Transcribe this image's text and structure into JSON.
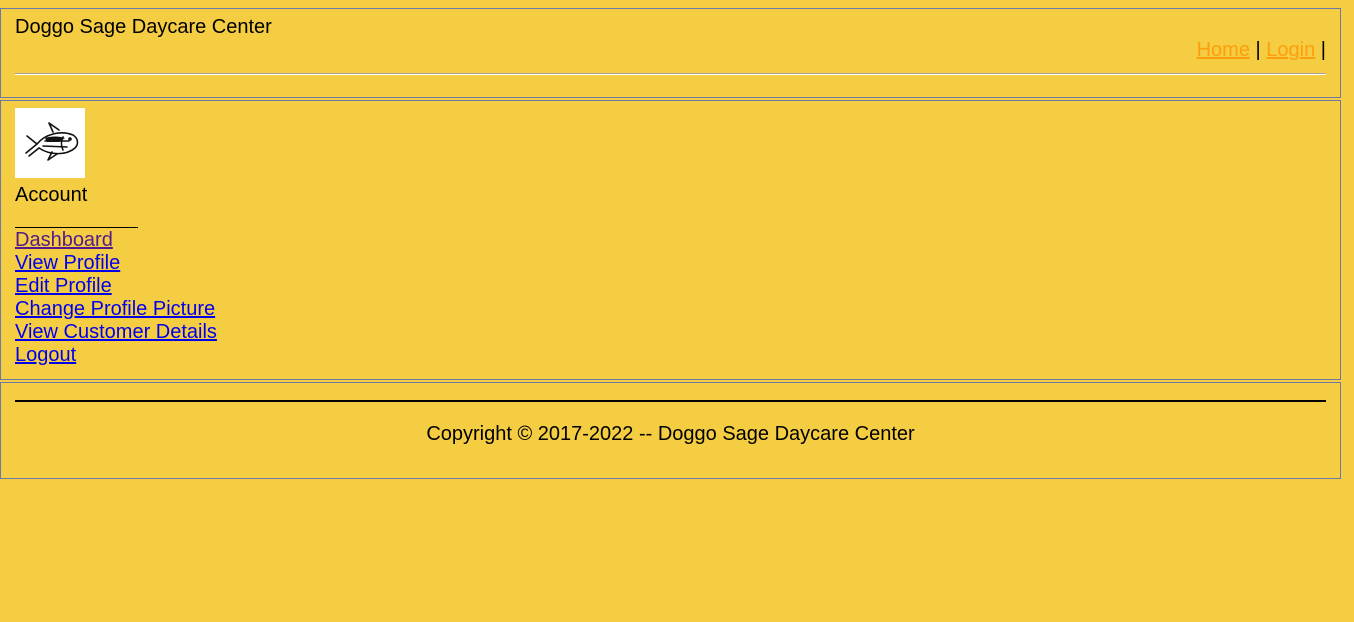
{
  "header": {
    "site_title": "Doggo Sage Daycare Center",
    "nav": [
      {
        "label": "Home"
      },
      {
        "label": "Login"
      }
    ],
    "separator": "|"
  },
  "sidebar": {
    "avatar_icon": "fish-sketch-icon",
    "heading": "Account",
    "items": [
      {
        "label": "Dashboard",
        "visited": true
      },
      {
        "label": "View Profile"
      },
      {
        "label": "Edit Profile"
      },
      {
        "label": "Change Profile Picture"
      },
      {
        "label": "View Customer Details"
      },
      {
        "label": "Logout"
      }
    ]
  },
  "footer": {
    "copyright": "Copyright © 2017-2022 -- Doggo Sage Daycare Center"
  },
  "colors": {
    "background": "#f4cd42",
    "frame_border": "#6b78a8",
    "top_nav_link": "#ff9e0d",
    "link": "#0000ee",
    "visited_link": "#551a8b"
  }
}
